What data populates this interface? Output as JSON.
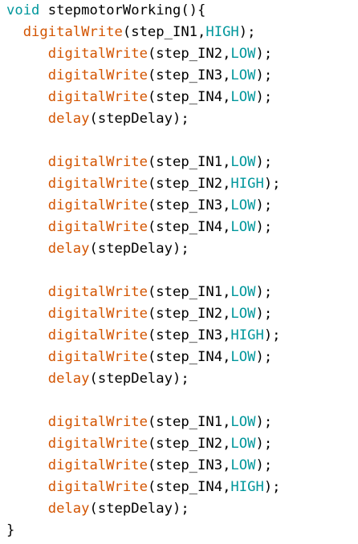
{
  "code": {
    "lines": [
      {
        "indent": "",
        "tokens": [
          {
            "t": "kw",
            "v": "void"
          },
          {
            "t": "plain",
            "v": " stepmotorWorking(){"
          }
        ]
      },
      {
        "indent": "  ",
        "tokens": [
          {
            "t": "fn",
            "v": "digitalWrite"
          },
          {
            "t": "plain",
            "v": "(step_IN1,"
          },
          {
            "t": "const",
            "v": "HIGH"
          },
          {
            "t": "plain",
            "v": ");"
          }
        ]
      },
      {
        "indent": "     ",
        "tokens": [
          {
            "t": "fn",
            "v": "digitalWrite"
          },
          {
            "t": "plain",
            "v": "(step_IN2,"
          },
          {
            "t": "const",
            "v": "LOW"
          },
          {
            "t": "plain",
            "v": ");"
          }
        ]
      },
      {
        "indent": "     ",
        "tokens": [
          {
            "t": "fn",
            "v": "digitalWrite"
          },
          {
            "t": "plain",
            "v": "(step_IN3,"
          },
          {
            "t": "const",
            "v": "LOW"
          },
          {
            "t": "plain",
            "v": ");"
          }
        ]
      },
      {
        "indent": "     ",
        "tokens": [
          {
            "t": "fn",
            "v": "digitalWrite"
          },
          {
            "t": "plain",
            "v": "(step_IN4,"
          },
          {
            "t": "const",
            "v": "LOW"
          },
          {
            "t": "plain",
            "v": ");"
          }
        ]
      },
      {
        "indent": "     ",
        "tokens": [
          {
            "t": "fn",
            "v": "delay"
          },
          {
            "t": "plain",
            "v": "(stepDelay);"
          }
        ]
      },
      {
        "indent": "",
        "tokens": []
      },
      {
        "indent": "     ",
        "tokens": [
          {
            "t": "fn",
            "v": "digitalWrite"
          },
          {
            "t": "plain",
            "v": "(step_IN1,"
          },
          {
            "t": "const",
            "v": "LOW"
          },
          {
            "t": "plain",
            "v": ");"
          }
        ]
      },
      {
        "indent": "     ",
        "tokens": [
          {
            "t": "fn",
            "v": "digitalWrite"
          },
          {
            "t": "plain",
            "v": "(step_IN2,"
          },
          {
            "t": "const",
            "v": "HIGH"
          },
          {
            "t": "plain",
            "v": ");"
          }
        ]
      },
      {
        "indent": "     ",
        "tokens": [
          {
            "t": "fn",
            "v": "digitalWrite"
          },
          {
            "t": "plain",
            "v": "(step_IN3,"
          },
          {
            "t": "const",
            "v": "LOW"
          },
          {
            "t": "plain",
            "v": ");"
          }
        ]
      },
      {
        "indent": "     ",
        "tokens": [
          {
            "t": "fn",
            "v": "digitalWrite"
          },
          {
            "t": "plain",
            "v": "(step_IN4,"
          },
          {
            "t": "const",
            "v": "LOW"
          },
          {
            "t": "plain",
            "v": ");"
          }
        ]
      },
      {
        "indent": "     ",
        "tokens": [
          {
            "t": "fn",
            "v": "delay"
          },
          {
            "t": "plain",
            "v": "(stepDelay);"
          }
        ]
      },
      {
        "indent": "",
        "tokens": []
      },
      {
        "indent": "     ",
        "tokens": [
          {
            "t": "fn",
            "v": "digitalWrite"
          },
          {
            "t": "plain",
            "v": "(step_IN1,"
          },
          {
            "t": "const",
            "v": "LOW"
          },
          {
            "t": "plain",
            "v": ");"
          }
        ]
      },
      {
        "indent": "     ",
        "tokens": [
          {
            "t": "fn",
            "v": "digitalWrite"
          },
          {
            "t": "plain",
            "v": "(step_IN2,"
          },
          {
            "t": "const",
            "v": "LOW"
          },
          {
            "t": "plain",
            "v": ");"
          }
        ]
      },
      {
        "indent": "     ",
        "tokens": [
          {
            "t": "fn",
            "v": "digitalWrite"
          },
          {
            "t": "plain",
            "v": "(step_IN3,"
          },
          {
            "t": "const",
            "v": "HIGH"
          },
          {
            "t": "plain",
            "v": ");"
          }
        ]
      },
      {
        "indent": "     ",
        "tokens": [
          {
            "t": "fn",
            "v": "digitalWrite"
          },
          {
            "t": "plain",
            "v": "(step_IN4,"
          },
          {
            "t": "const",
            "v": "LOW"
          },
          {
            "t": "plain",
            "v": ");"
          }
        ]
      },
      {
        "indent": "     ",
        "tokens": [
          {
            "t": "fn",
            "v": "delay"
          },
          {
            "t": "plain",
            "v": "(stepDelay);"
          }
        ]
      },
      {
        "indent": "",
        "tokens": []
      },
      {
        "indent": "     ",
        "tokens": [
          {
            "t": "fn",
            "v": "digitalWrite"
          },
          {
            "t": "plain",
            "v": "(step_IN1,"
          },
          {
            "t": "const",
            "v": "LOW"
          },
          {
            "t": "plain",
            "v": ");"
          }
        ]
      },
      {
        "indent": "     ",
        "tokens": [
          {
            "t": "fn",
            "v": "digitalWrite"
          },
          {
            "t": "plain",
            "v": "(step_IN2,"
          },
          {
            "t": "const",
            "v": "LOW"
          },
          {
            "t": "plain",
            "v": ");"
          }
        ]
      },
      {
        "indent": "     ",
        "tokens": [
          {
            "t": "fn",
            "v": "digitalWrite"
          },
          {
            "t": "plain",
            "v": "(step_IN3,"
          },
          {
            "t": "const",
            "v": "LOW"
          },
          {
            "t": "plain",
            "v": ");"
          }
        ]
      },
      {
        "indent": "     ",
        "tokens": [
          {
            "t": "fn",
            "v": "digitalWrite"
          },
          {
            "t": "plain",
            "v": "(step_IN4,"
          },
          {
            "t": "const",
            "v": "HIGH"
          },
          {
            "t": "plain",
            "v": ");"
          }
        ]
      },
      {
        "indent": "     ",
        "tokens": [
          {
            "t": "fn",
            "v": "delay"
          },
          {
            "t": "plain",
            "v": "(stepDelay);"
          }
        ]
      },
      {
        "indent": "",
        "tokens": [
          {
            "t": "plain",
            "v": "}"
          }
        ]
      }
    ]
  },
  "colors": {
    "keyword": "#00979c",
    "function": "#d35400",
    "constant": "#00979c",
    "text": "#000000",
    "background": "#ffffff"
  }
}
